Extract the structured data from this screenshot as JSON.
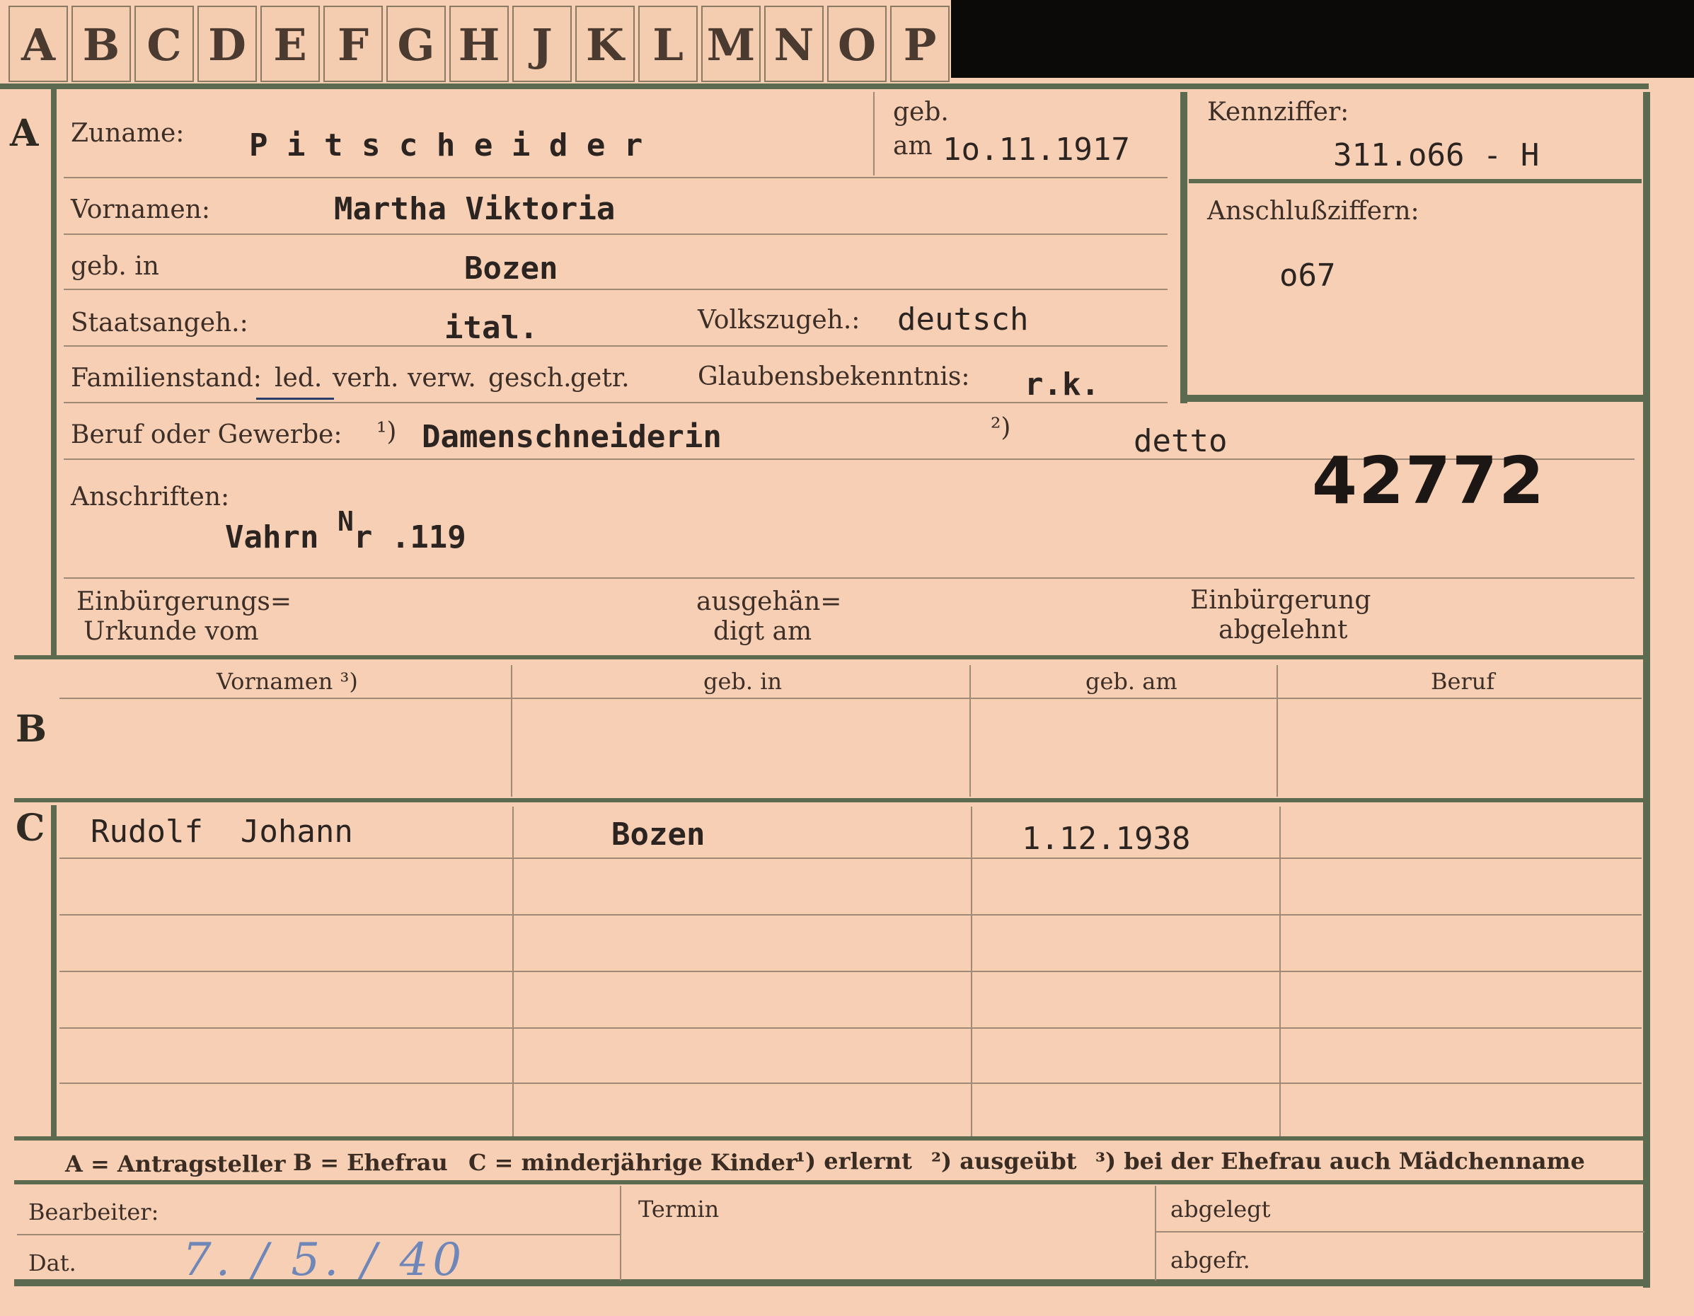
{
  "tabs": [
    "A",
    "B",
    "C",
    "D",
    "E",
    "F",
    "G",
    "H",
    "J",
    "K",
    "L",
    "M",
    "N",
    "O",
    "P"
  ],
  "section_letters": {
    "a": "A",
    "b": "B",
    "c": "C"
  },
  "section_a": {
    "surname_label": "Zuname:",
    "surname_value": "P i t s c h e i d e r",
    "born_label_line1": "geb.",
    "born_label_line2": "am",
    "born_value": "1o.11.1917",
    "kennziffer_label": "Kennziffer:",
    "kennziffer_value": "311.o66 - H",
    "anschluss_label": "Anschlußziffern:",
    "anschluss_value": "o67",
    "first_names_label": "Vornamen:",
    "first_names_value": "Martha Viktoria",
    "birthplace_label": "geb. in",
    "birthplace_value": "Bozen",
    "citizenship_label": "Staatsangeh.:",
    "citizenship_value": "ital.",
    "ethnicity_label": "Volkszugeh.:",
    "ethnicity_value": "deutsch",
    "marital_label": "Familienstand:",
    "marital_options": [
      "led.",
      "verh.",
      "verw.",
      "gesch.",
      "getr."
    ],
    "marital_selected": "led.",
    "religion_label": "Glaubensbekenntnis:",
    "religion_value": "r.k.",
    "profession_label": "Beruf oder Gewerbe:",
    "profession_note1": "¹)",
    "profession_value": "Damenschneiderin",
    "profession_note2": "²)",
    "profession_value2": "detto",
    "number_stamp": "42772",
    "address_label": "Anschriften:",
    "address_value": "Vahrn",
    "address_nr_sup": "N",
    "address_nr_rest": "r .119",
    "naturalisation_line1": "Einbürgerungs=",
    "naturalisation_line2": "Urkunde vom",
    "handed_line1": "ausgehän=",
    "handed_line2": "digt am",
    "refused_line1": "Einbürgerung",
    "refused_line2": "abgelehnt"
  },
  "table_headers": [
    "Vornamen ³)",
    "geb. in",
    "geb. am",
    "Beruf"
  ],
  "section_c_rows": [
    {
      "first_names": "Rudolf  Johann",
      "birthplace": "Bozen",
      "birthdate": "1.12.1938",
      "profession": ""
    }
  ],
  "legend": {
    "a": "A = Antragsteller",
    "b": "B = Ehefrau",
    "c": "C = minderjährige Kinder",
    "n1": "¹) erlernt",
    "n2": "²) ausgeübt",
    "n3": "³) bei der Ehefrau auch Mädchenname"
  },
  "footer": {
    "bearbeiter_label": "Bearbeiter:",
    "date_label": "Dat.",
    "date_value": "7. / 5. / 40",
    "termin_label": "Termin",
    "abgelegt_label": "abgelegt",
    "abgefr_label": "abgefr."
  },
  "colors": {
    "card": "#f6cfb4",
    "frame": "#5c6b50",
    "background": "#0c0a08",
    "ink_blue": "#6f86b8"
  }
}
